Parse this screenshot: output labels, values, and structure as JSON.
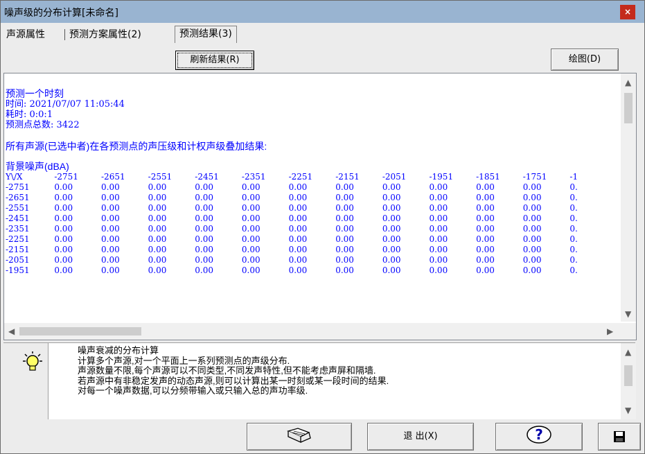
{
  "window": {
    "title": "噪声级的分布计算[未命名]",
    "close_label": "×"
  },
  "tabs": [
    {
      "label": "声源属性"
    },
    {
      "label": "预测方案属性(2)"
    },
    {
      "label": "预测结果(3)"
    }
  ],
  "toolbar": {
    "refresh_label": "刷新结果(R)",
    "plot_label": "绘图(D)"
  },
  "results": {
    "header_lines": [
      "预测一个时刻",
      "时间: 2021/07/07 11:05:44",
      "耗时: 0:0:1",
      "预测点总数: 3422"
    ],
    "summary": "所有声源(已选中者)在各预测点的声压级和计权声级叠加结果:",
    "section_title": "背景噪声(dBA)",
    "corner_label": "Y\\/X",
    "col_headers": [
      "-2751",
      "-2651",
      "-2551",
      "-2451",
      "-2351",
      "-2251",
      "-2151",
      "-2051",
      "-1951",
      "-1851",
      "-1751",
      "-1"
    ],
    "rows": [
      {
        "y": "-2751",
        "values": [
          "0.00",
          "0.00",
          "0.00",
          "0.00",
          "0.00",
          "0.00",
          "0.00",
          "0.00",
          "0.00",
          "0.00",
          "0.00",
          "0."
        ]
      },
      {
        "y": "-2651",
        "values": [
          "0.00",
          "0.00",
          "0.00",
          "0.00",
          "0.00",
          "0.00",
          "0.00",
          "0.00",
          "0.00",
          "0.00",
          "0.00",
          "0."
        ]
      },
      {
        "y": "-2551",
        "values": [
          "0.00",
          "0.00",
          "0.00",
          "0.00",
          "0.00",
          "0.00",
          "0.00",
          "0.00",
          "0.00",
          "0.00",
          "0.00",
          "0."
        ]
      },
      {
        "y": "-2451",
        "values": [
          "0.00",
          "0.00",
          "0.00",
          "0.00",
          "0.00",
          "0.00",
          "0.00",
          "0.00",
          "0.00",
          "0.00",
          "0.00",
          "0."
        ]
      },
      {
        "y": "-2351",
        "values": [
          "0.00",
          "0.00",
          "0.00",
          "0.00",
          "0.00",
          "0.00",
          "0.00",
          "0.00",
          "0.00",
          "0.00",
          "0.00",
          "0."
        ]
      },
      {
        "y": "-2251",
        "values": [
          "0.00",
          "0.00",
          "0.00",
          "0.00",
          "0.00",
          "0.00",
          "0.00",
          "0.00",
          "0.00",
          "0.00",
          "0.00",
          "0."
        ]
      },
      {
        "y": "-2151",
        "values": [
          "0.00",
          "0.00",
          "0.00",
          "0.00",
          "0.00",
          "0.00",
          "0.00",
          "0.00",
          "0.00",
          "0.00",
          "0.00",
          "0."
        ]
      },
      {
        "y": "-2051",
        "values": [
          "0.00",
          "0.00",
          "0.00",
          "0.00",
          "0.00",
          "0.00",
          "0.00",
          "0.00",
          "0.00",
          "0.00",
          "0.00",
          "0."
        ]
      },
      {
        "y": "-1951",
        "values": [
          "0.00",
          "0.00",
          "0.00",
          "0.00",
          "0.00",
          "0.00",
          "0.00",
          "0.00",
          "0.00",
          "0.00",
          "0.00",
          "0."
        ]
      }
    ]
  },
  "info": {
    "icon": "lightbulb-icon",
    "lines": [
      "噪声衰减的分布计算",
      "计算多个声源,对一个平面上一系列预测点的声级分布.",
      "声源数量不限,每个声源可以不同类型,不同发声特性,但不能考虑声屏和隔墙.",
      "若声源中有非稳定发声的动态声源,则可以计算出某一时刻或某一段时间的结果.",
      "对每一个噪声数据,可以分频带输入或只输入总的声功率级."
    ]
  },
  "bottom": {
    "help_icon": "book-icon",
    "exit_label": "退 出(X)",
    "question_icon": "question-icon",
    "save_icon": "floppy-icon"
  },
  "colors": {
    "titlebar": "#99b4d1",
    "close": "#c42b1c",
    "result_text": "#0000ff"
  }
}
